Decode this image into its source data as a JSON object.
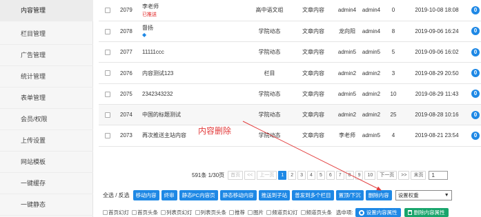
{
  "sidebar": {
    "items": [
      {
        "label": "内容管理",
        "active": true
      },
      {
        "label": "栏目管理",
        "active": false
      },
      {
        "label": "广告管理",
        "active": false
      },
      {
        "label": "统计管理",
        "active": false
      },
      {
        "label": "表单管理",
        "active": false
      },
      {
        "label": "会员/权限",
        "active": false
      },
      {
        "label": "上传设置",
        "active": false
      },
      {
        "label": "网站模板",
        "active": false
      },
      {
        "label": "一键缓存",
        "active": false
      },
      {
        "label": "一键静态",
        "active": false
      }
    ]
  },
  "table": {
    "rows": [
      {
        "id": "2079",
        "title": "李老师",
        "tag": "已推送",
        "column": "高中语文组",
        "type": "文章内容",
        "author": "admin4",
        "editor": "admin4",
        "views": "0",
        "date": "2019-10-08 18:08",
        "badge": "0"
      },
      {
        "id": "2078",
        "title": "督扬",
        "arrow": "◆",
        "column": "学院动态",
        "type": "文章内容",
        "author": "龙向阳",
        "editor": "admin4",
        "views": "8",
        "date": "2019-09-06 16:24",
        "badge": "0"
      },
      {
        "id": "2077",
        "title": "11111ccc",
        "column": "学院动态",
        "type": "文章内容",
        "author": "admin5",
        "editor": "admin5",
        "views": "5",
        "date": "2019-09-06 16:02",
        "badge": "0"
      },
      {
        "id": "2076",
        "title": "内容测试123",
        "column": "栏目",
        "type": "文章内容",
        "author": "admin2",
        "editor": "admin2",
        "views": "3",
        "date": "2019-08-29 20:50",
        "badge": "0"
      },
      {
        "id": "2075",
        "title": "2342343232",
        "column": "学院动态",
        "type": "文章内容",
        "author": "admin5",
        "editor": "admin2",
        "views": "10",
        "date": "2019-08-29 11:43",
        "badge": "0"
      },
      {
        "id": "2074",
        "title": "中国的标题测试",
        "column": "学院动态",
        "type": "文章内容",
        "author": "admin2",
        "editor": "admin2",
        "views": "25",
        "date": "2019-08-28 10:16",
        "badge": "0"
      },
      {
        "id": "2073",
        "title": "再次推送主站内容",
        "column": "学院动态",
        "type": "文章内容",
        "author": "李老师",
        "editor": "admin5",
        "views": "4",
        "date": "2019-08-21 23:54",
        "badge": "0"
      }
    ]
  },
  "pagination": {
    "total": "591条 1/30页",
    "first": "首页",
    "prev_group": "<<",
    "prev": "上一页",
    "pages": [
      "1",
      "2",
      "3",
      "4",
      "5",
      "6",
      "7",
      "8",
      "9",
      "10"
    ],
    "current": "1",
    "next": "下一页",
    "next_group": ">>",
    "last": "末页",
    "jump_value": "1"
  },
  "bulk": {
    "select_all": "全选 / 反选",
    "buttons": [
      "移动内容",
      "终审",
      "静态PC内容页",
      "静态移动内容",
      "推送到子站",
      "普发到多个栏目",
      "置顶/下沉",
      "删除内容"
    ],
    "select_value": "设置权重"
  },
  "flags": {
    "items": [
      "首页幻灯",
      "首页头条",
      "列表页幻灯",
      "列表页头条",
      "推荐",
      "图片",
      "频道页幻灯",
      "频道页头条"
    ],
    "selected_label": "选中项:",
    "set_attr": "设置内容属性",
    "del_attr": "删除内容属性"
  },
  "annotation": {
    "text": "内容删除",
    "color": "#e23a3a"
  },
  "colors": {
    "accent": "#1e88e5",
    "green": "#18a56c"
  }
}
